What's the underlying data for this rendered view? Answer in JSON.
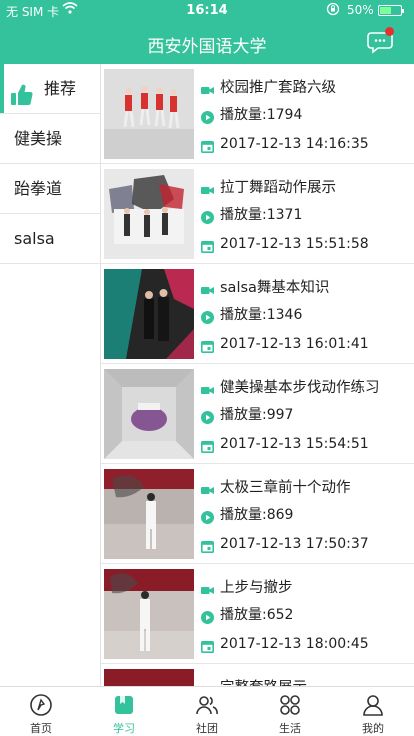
{
  "status_bar": {
    "carrier": "无 SIM 卡",
    "time": "16:14",
    "battery": "50%"
  },
  "header": {
    "title": "西安外国语大学"
  },
  "sidebar": {
    "items": [
      {
        "label": "推荐",
        "active": true
      },
      {
        "label": "健美操",
        "active": false
      },
      {
        "label": "跆拳道",
        "active": false
      },
      {
        "label": "salsa",
        "active": false
      }
    ]
  },
  "videos": [
    {
      "title": "校园推广套路六级",
      "plays": "播放量:1794",
      "date": "2017-12-13 14:16:35",
      "thumb_bg": "#d9d9d9"
    },
    {
      "title": "拉丁舞蹈动作展示",
      "plays": "播放量:1371",
      "date": "2017-12-13 15:51:58",
      "thumb_bg": "#e5e5e5"
    },
    {
      "title": "salsa舞基本知识",
      "plays": "播放量:1346",
      "date": "2017-12-13 16:01:41",
      "thumb_bg": "#3b3b3b"
    },
    {
      "title": "健美操基本步伐动作练习",
      "plays": "播放量:997",
      "date": "2017-12-13 15:54:51",
      "thumb_bg": "#d6d6d6"
    },
    {
      "title": "太极三章前十个动作",
      "plays": "播放量:869",
      "date": "2017-12-13 17:50:37",
      "thumb_bg": "#b9b3b0"
    },
    {
      "title": "上步与撤步",
      "plays": "播放量:652",
      "date": "2017-12-13 18:00:45",
      "thumb_bg": "#c9c3c0"
    },
    {
      "title": "完整套路展示",
      "plays": "",
      "date": "",
      "thumb_bg": "#c9c3c0"
    }
  ],
  "tabbar": {
    "tabs": [
      {
        "label": "首页",
        "icon": "compass-icon"
      },
      {
        "label": "学习",
        "icon": "book-icon",
        "active": true
      },
      {
        "label": "社团",
        "icon": "people-icon"
      },
      {
        "label": "生活",
        "icon": "grid-icon"
      },
      {
        "label": "我的",
        "icon": "person-icon"
      }
    ]
  },
  "colors": {
    "accent": "#33c29b",
    "badge": "#e63030"
  }
}
